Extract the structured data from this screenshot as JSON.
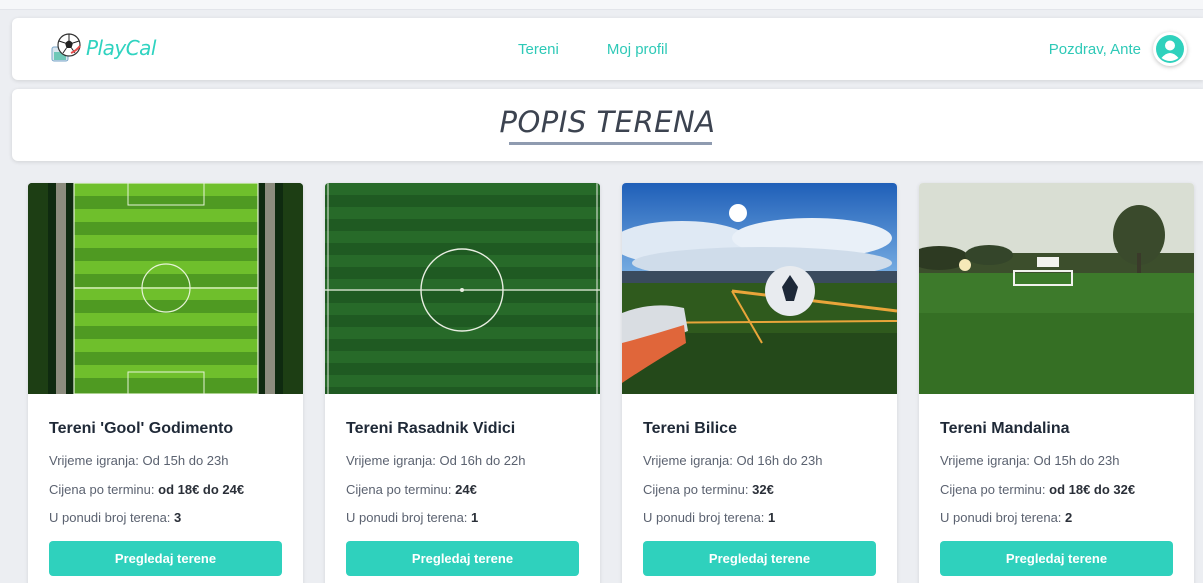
{
  "app": {
    "logo_text": "PlayCal"
  },
  "nav": {
    "links": [
      "Tereni",
      "Moj profil"
    ],
    "greeting": "Pozdrav, Ante"
  },
  "page": {
    "title": "POPIS TERENA"
  },
  "colors": {
    "accent": "#2fd1bd",
    "background": "#eceef2",
    "title_underline": "#8f9bb0"
  },
  "cards": [
    {
      "title": "Tereni 'Gool' Godimento",
      "time_label": "Vrijeme igranja:",
      "time_value": "Od 15h do 23h",
      "price_label": "Cijena po terminu:",
      "price_value": "od 18€ do 24€",
      "courts_label": "U ponudi broj terena:",
      "courts_value": "3",
      "button": "Pregledaj terene"
    },
    {
      "title": "Tereni Rasadnik Vidici",
      "time_label": "Vrijeme igranja:",
      "time_value": "Od 16h do 22h",
      "price_label": "Cijena po terminu:",
      "price_value": "24€",
      "courts_label": "U ponudi broj terena:",
      "courts_value": "1",
      "button": "Pregledaj terene"
    },
    {
      "title": "Tereni Bilice",
      "time_label": "Vrijeme igranja:",
      "time_value": "Od 16h do 23h",
      "price_label": "Cijena po terminu:",
      "price_value": "32€",
      "courts_label": "U ponudi broj terena:",
      "courts_value": "1",
      "button": "Pregledaj terene"
    },
    {
      "title": "Tereni Mandalina",
      "time_label": "Vrijeme igranja:",
      "time_value": "Od 15h do 23h",
      "price_label": "Cijena po terminu:",
      "price_value": "od 18€ do 32€",
      "courts_label": "U ponudi broj terena:",
      "courts_value": "2",
      "button": "Pregledaj terene"
    }
  ]
}
